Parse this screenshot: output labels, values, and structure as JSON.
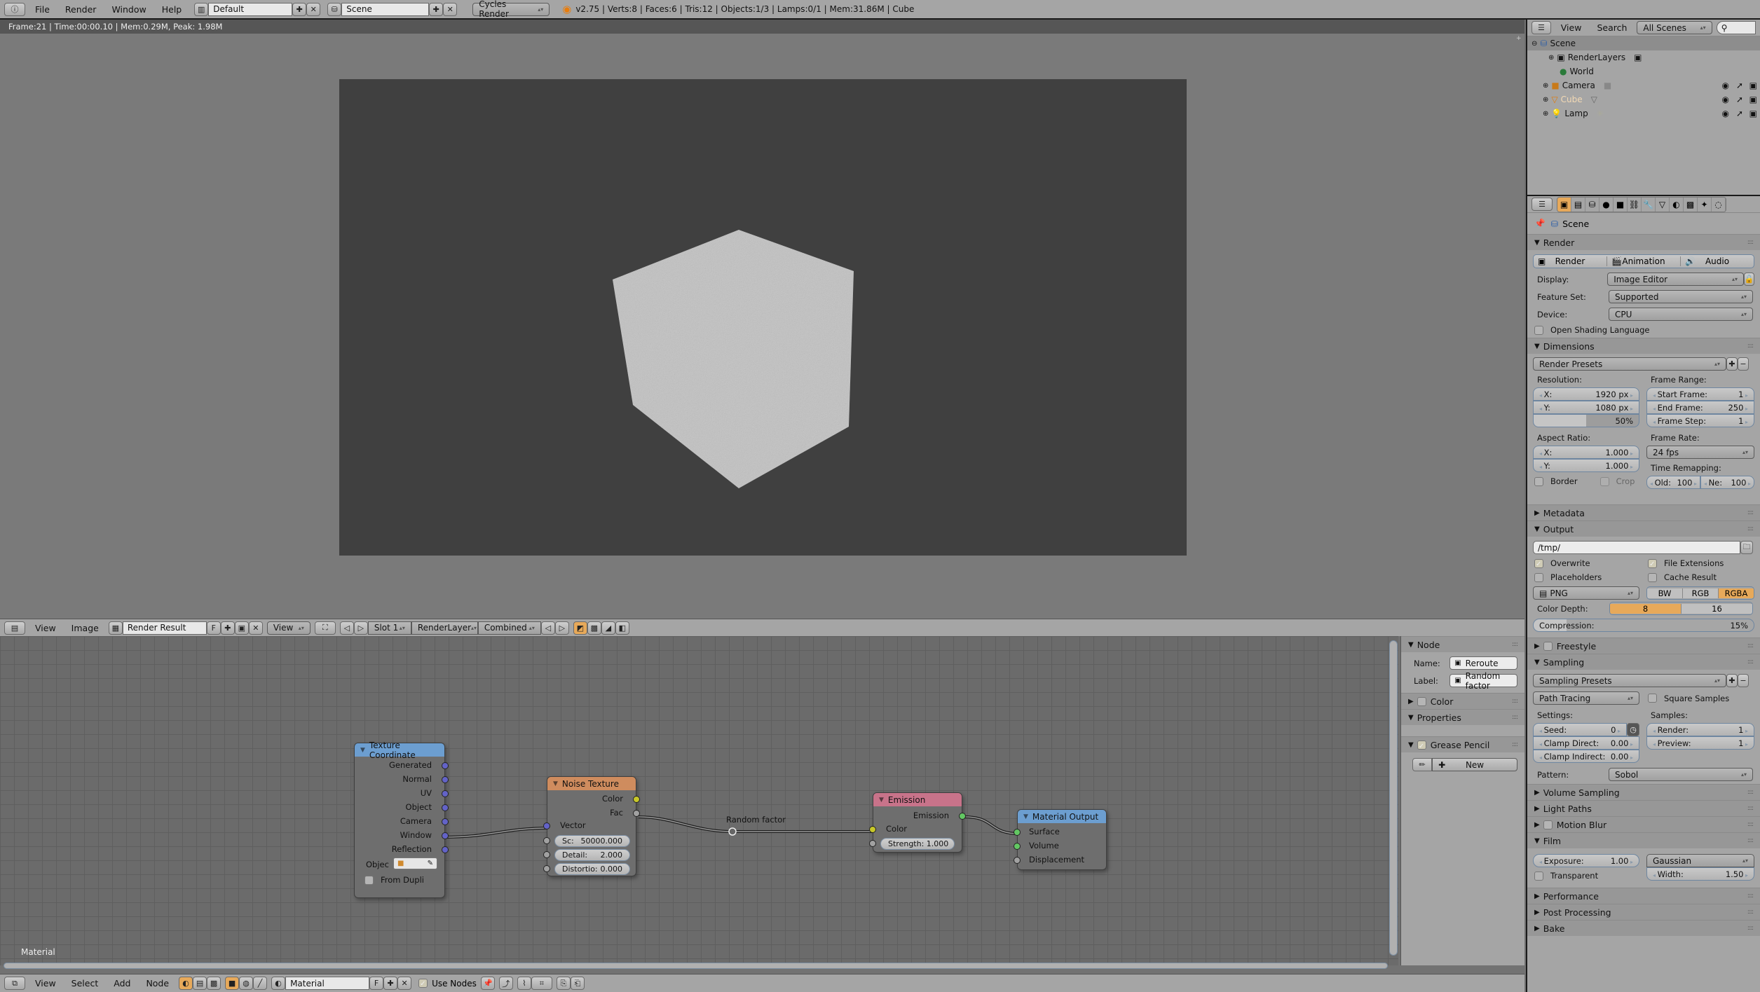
{
  "top_bar": {
    "menus": [
      "File",
      "Render",
      "Window",
      "Help"
    ],
    "layout_name": "Default",
    "scene_name": "Scene",
    "render_engine": "Cycles Render",
    "stats": "v2.75 | Verts:8 | Faces:6 | Tris:12 | Objects:1/3 | Lamps:0/1 | Mem:31.86M | Cube"
  },
  "image_editor": {
    "render_info": "Frame:21 | Time:00:00.10 | Mem:0.29M, Peak: 1.98M",
    "header": {
      "menus": [
        "View",
        "Image"
      ],
      "image_name": "Render Result",
      "fake_user": "F",
      "view_label": "View",
      "slot": "Slot 1",
      "layer": "RenderLayer",
      "pass": "Combined"
    }
  },
  "node_editor": {
    "tree_label": "Material",
    "nodes": {
      "texture_coordinate": {
        "title": "Texture Coordinate",
        "outputs": [
          "Generated",
          "Normal",
          "UV",
          "Object",
          "Camera",
          "Window",
          "Reflection"
        ],
        "object_label": "Objec",
        "from_dupli": "From Dupli",
        "header_color": "#6c9ed0"
      },
      "noise_texture": {
        "title": "Noise Texture",
        "outputs": [
          "Color",
          "Fac"
        ],
        "vector_input": "Vector",
        "fields": [
          {
            "label": "Sc:",
            "value": "50000.000"
          },
          {
            "label": "Detail:",
            "value": "2.000"
          },
          {
            "label": "Distortio:",
            "value": "0.000"
          }
        ],
        "header_color": "#cf8c5e"
      },
      "reroute": {
        "label": "Random factor"
      },
      "emission": {
        "title": "Emission",
        "output": "Emission",
        "color_input": "Color",
        "strength": {
          "label": "Strength:",
          "value": "1.000"
        },
        "header_color": "#c8738a"
      },
      "material_output": {
        "title": "Material Output",
        "inputs": [
          "Surface",
          "Volume",
          "Displacement"
        ],
        "header_color": "#6c9ed0"
      }
    },
    "sidebar": {
      "node_panel": "Node",
      "name_label": "Name:",
      "name_value": "Reroute",
      "label_label": "Label:",
      "label_value": "Random factor",
      "color_panel": "Color",
      "properties_panel": "Properties",
      "grease_panel": "Grease Pencil",
      "new_button": "New"
    },
    "header": {
      "menus": [
        "View",
        "Select",
        "Add",
        "Node"
      ],
      "material_name": "Material",
      "fake_user": "F",
      "use_nodes": "Use Nodes"
    }
  },
  "outliner": {
    "menus": [
      "View",
      "Search"
    ],
    "filter": "All Scenes",
    "items": [
      {
        "name": "Scene",
        "icon": "scene-icon",
        "level": 0
      },
      {
        "name": "RenderLayers",
        "icon": "renderlayers-icon",
        "level": 1
      },
      {
        "name": "World",
        "icon": "world-icon",
        "level": 1
      },
      {
        "name": "Camera",
        "icon": "camera-icon",
        "level": 1
      },
      {
        "name": "Cube",
        "icon": "mesh-icon",
        "level": 1
      },
      {
        "name": "Lamp",
        "icon": "lamp-icon",
        "level": 1
      }
    ]
  },
  "properties": {
    "context": "Scene",
    "render": {
      "title": "Render",
      "buttons": [
        "Render",
        "Animation",
        "Audio"
      ],
      "display_label": "Display:",
      "display_value": "Image Editor",
      "feature_label": "Feature Set:",
      "feature_value": "Supported",
      "device_label": "Device:",
      "device_value": "CPU",
      "osl": "Open Shading Language"
    },
    "dimensions": {
      "title": "Dimensions",
      "presets": "Render Presets",
      "resolution_label": "Resolution:",
      "res_x_label": "X:",
      "res_x": "1920 px",
      "res_y_label": "Y:",
      "res_y": "1080 px",
      "res_pct": "50%",
      "res_pct_value": 50,
      "frame_range_label": "Frame Range:",
      "start_label": "Start Frame:",
      "start": "1",
      "end_label": "End Frame:",
      "end": "250",
      "step_label": "Frame Step:",
      "step": "1",
      "aspect_label": "Aspect Ratio:",
      "asp_x_label": "X:",
      "asp_x": "1.000",
      "asp_y_label": "Y:",
      "asp_y": "1.000",
      "border": "Border",
      "crop": "Crop",
      "frame_rate_label": "Frame Rate:",
      "frame_rate": "24 fps",
      "remap_label": "Time Remapping:",
      "old_label": "Old:",
      "old": "100",
      "new_label": "Ne:",
      "new": "100"
    },
    "metadata": {
      "title": "Metadata"
    },
    "output": {
      "title": "Output",
      "path": "/tmp/",
      "overwrite": "Overwrite",
      "file_extensions": "File Extensions",
      "placeholders": "Placeholders",
      "cache_result": "Cache Result",
      "format": "PNG",
      "color_modes": [
        "BW",
        "RGB",
        "RGBA"
      ],
      "color_mode_active": "RGBA",
      "depth_label": "Color Depth:",
      "depths": [
        "8",
        "16"
      ],
      "compression_label": "Compression:",
      "compression": "15%",
      "compression_value": 15
    },
    "freestyle": {
      "title": "Freestyle"
    },
    "sampling": {
      "title": "Sampling",
      "presets": "Sampling Presets",
      "integrator": "Path Tracing",
      "square_samples": "Square Samples",
      "settings_label": "Settings:",
      "seed_label": "Seed:",
      "seed": "0",
      "clamp_direct_label": "Clamp Direct:",
      "clamp_direct": "0.00",
      "clamp_indirect_label": "Clamp Indirect:",
      "clamp_indirect": "0.00",
      "samples_label": "Samples:",
      "render_label": "Render:",
      "render": "1",
      "preview_label": "Preview:",
      "preview": "1",
      "pattern_label": "Pattern:",
      "pattern": "Sobol"
    },
    "collapsed_panels": [
      "Volume Sampling",
      "Light Paths",
      "Motion Blur"
    ],
    "film": {
      "title": "Film",
      "exposure_label": "Exposure:",
      "exposure": "1.00",
      "transparent": "Transparent",
      "filter": "Gaussian",
      "width_label": "Width:",
      "width": "1.50"
    },
    "bottom_panels": [
      "Performance",
      "Post Processing",
      "Bake"
    ]
  }
}
